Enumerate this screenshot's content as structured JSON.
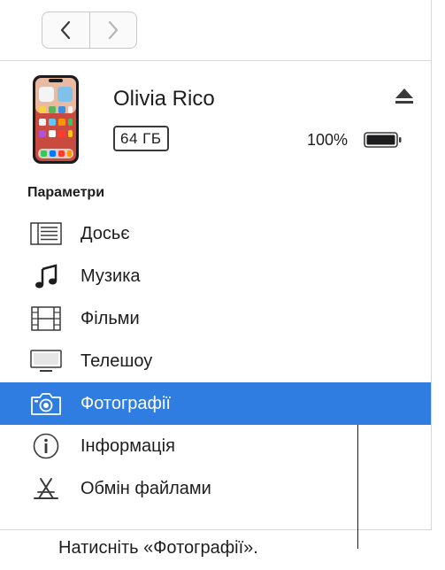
{
  "toolbar": {
    "back": "chevron-left-icon",
    "forward": "chevron-right-icon"
  },
  "device": {
    "name": "Olivia Rico",
    "capacity": "64 ГБ",
    "battery_percent_label": "100%",
    "battery_level": 1.0
  },
  "settings": {
    "title": "Параметри",
    "items": [
      {
        "label": "Досьє",
        "icon": "summary-list-icon"
      },
      {
        "label": "Музика",
        "icon": "music-note-icon"
      },
      {
        "label": "Фільми",
        "icon": "film-icon"
      },
      {
        "label": "Телешоу",
        "icon": "tv-icon"
      },
      {
        "label": "Фотографії",
        "icon": "camera-icon",
        "selected": true
      },
      {
        "label": "Інформація",
        "icon": "info-icon"
      },
      {
        "label": "Обмін файлами",
        "icon": "file-sharing-icon"
      }
    ]
  },
  "caption": "Натисніть «Фотографії».",
  "colors": {
    "selection": "#2f7de1",
    "text": "#1d1d1f"
  }
}
